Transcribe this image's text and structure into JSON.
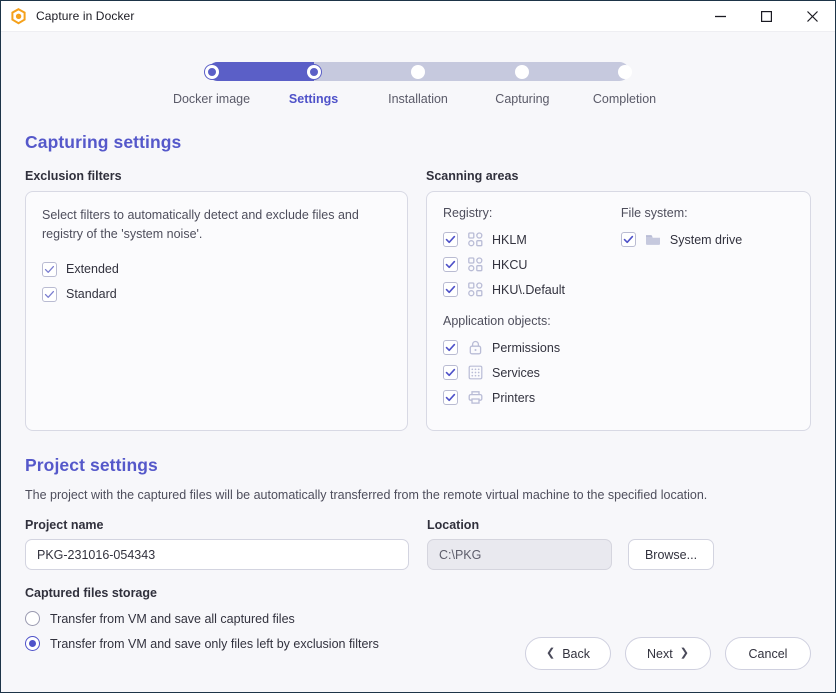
{
  "window": {
    "title": "Capture in Docker",
    "logo_icon": "docker-capture-logo-icon",
    "minimize_label": "Minimize",
    "maximize_label": "Maximize",
    "close_label": "Close"
  },
  "stepper": {
    "active_index": 1,
    "fill_percent": 25,
    "active_color": "#5b5fc7",
    "inactive_color": "#c6c9de",
    "steps": [
      {
        "label": "Docker image",
        "state": "done"
      },
      {
        "label": "Settings",
        "state": "active"
      },
      {
        "label": "Installation",
        "state": "pending"
      },
      {
        "label": "Capturing",
        "state": "pending"
      },
      {
        "label": "Completion",
        "state": "pending"
      }
    ]
  },
  "capturing": {
    "heading": "Capturing settings",
    "heading_color": "#5558ca",
    "exclusion": {
      "label": "Exclusion filters",
      "description": "Select filters to automatically detect and exclude files and registry of the 'system noise'.",
      "filters": [
        {
          "label": "Extended",
          "checked": true
        },
        {
          "label": "Standard",
          "checked": true
        }
      ]
    },
    "scanning": {
      "label": "Scanning areas",
      "registry_title": "Registry:",
      "registry_items": [
        {
          "label": "HKLM",
          "checked": true,
          "icon": "registry-icon"
        },
        {
          "label": "HKCU",
          "checked": true,
          "icon": "registry-icon"
        },
        {
          "label": "HKU\\.Default",
          "checked": true,
          "icon": "registry-icon"
        }
      ],
      "app_objects_title": "Application objects:",
      "app_objects": [
        {
          "label": "Permissions",
          "checked": true,
          "icon": "lock-icon"
        },
        {
          "label": "Services",
          "checked": true,
          "icon": "grid-icon"
        },
        {
          "label": "Printers",
          "checked": true,
          "icon": "printer-icon"
        }
      ],
      "filesystem_title": "File system:",
      "filesystem_items": [
        {
          "label": "System drive",
          "checked": true,
          "icon": "folder-icon"
        }
      ]
    }
  },
  "project": {
    "heading": "Project settings",
    "description": "The project with the captured files will be automatically transferred from the remote virtual machine to the specified location.",
    "name_label": "Project name",
    "name_value": "PKG-231016-054343",
    "location_label": "Location",
    "location_value": "C:\\PKG",
    "location_disabled": true,
    "browse_label": "Browse...",
    "storage_label": "Captured files storage",
    "storage_options": [
      {
        "label": "Transfer from VM and save all captured files",
        "selected": false
      },
      {
        "label": "Transfer from VM and save only files left by exclusion filters",
        "selected": true
      }
    ]
  },
  "footer": {
    "back_label": "Back",
    "next_label": "Next",
    "cancel_label": "Cancel",
    "back_icon": "chevron-left-icon",
    "next_icon": "chevron-right-icon"
  }
}
